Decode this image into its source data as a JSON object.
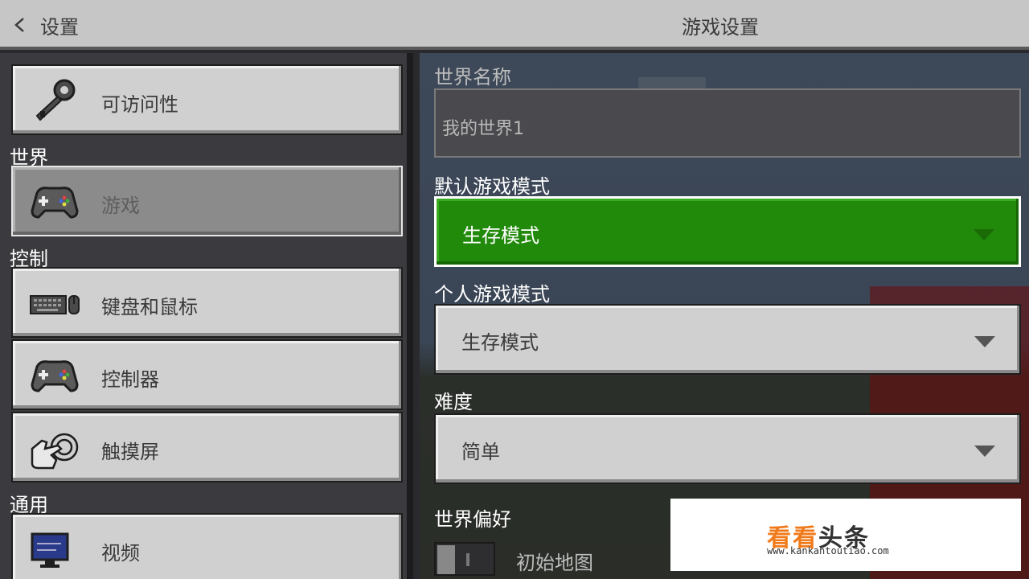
{
  "header": {
    "back_label": "设置",
    "title": "游戏设置"
  },
  "sidebar": {
    "sections": {
      "world": "世界",
      "controls": "控制",
      "general": "通用"
    },
    "items": [
      {
        "label": "可访问性",
        "icon": "key-icon",
        "selected": false
      },
      {
        "label": "游戏",
        "icon": "gamepad-icon",
        "selected": true
      },
      {
        "label": "键盘和鼠标",
        "icon": "keyboard-mouse-icon",
        "selected": false
      },
      {
        "label": "控制器",
        "icon": "controller-icon",
        "selected": false
      },
      {
        "label": "触摸屏",
        "icon": "touch-hand-icon",
        "selected": false
      },
      {
        "label": "视频",
        "icon": "monitor-icon",
        "selected": false
      }
    ]
  },
  "main": {
    "world_name": {
      "label": "世界名称",
      "value": "我的世界1"
    },
    "default_game_mode": {
      "label": "默认游戏模式",
      "value": "生存模式"
    },
    "personal_game_mode": {
      "label": "个人游戏模式",
      "value": "生存模式"
    },
    "difficulty": {
      "label": "难度",
      "value": "简单"
    },
    "world_preferences": {
      "label": "世界偏好"
    },
    "starting_map": {
      "label": "初始地图",
      "enabled": false
    }
  },
  "watermark": {
    "title_a": "看看",
    "title_b": "头条",
    "url": "www.kankantoutiao.com"
  },
  "colors": {
    "accent_green": "#218a0a",
    "button_gray": "#d0d0d0",
    "header_gray": "#c6c6c6"
  }
}
